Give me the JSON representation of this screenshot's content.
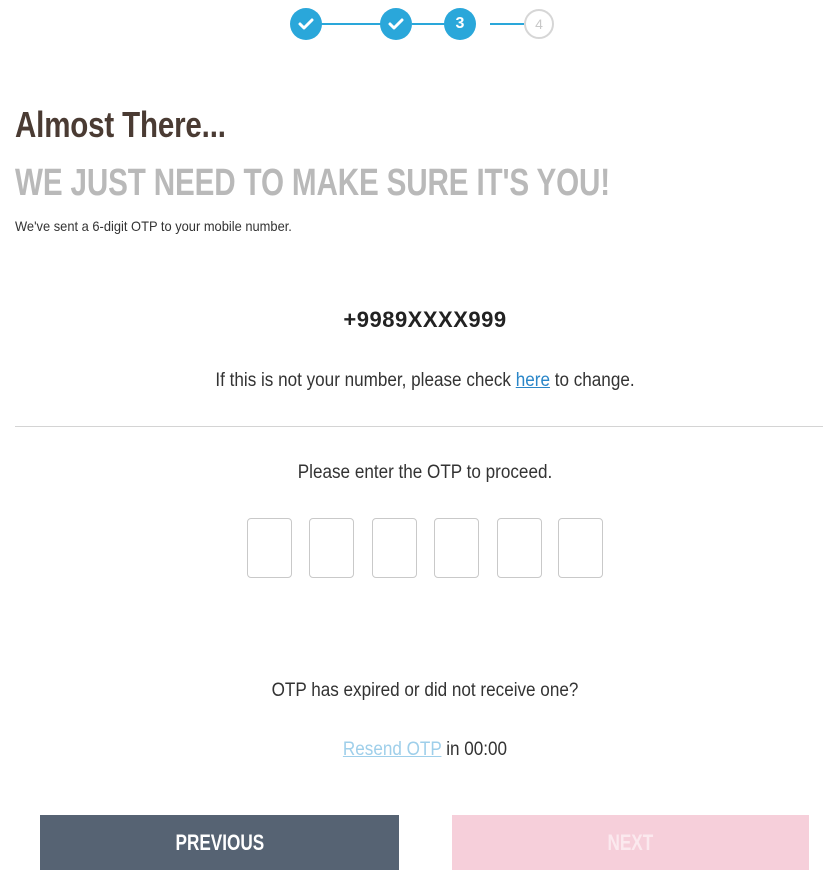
{
  "stepper": {
    "steps": [
      {
        "state": "completed",
        "icon": "check-icon",
        "label": ""
      },
      {
        "state": "completed",
        "icon": "check-icon",
        "label": ""
      },
      {
        "state": "current",
        "label": "3"
      },
      {
        "state": "pending",
        "label": "4"
      }
    ],
    "active_color": "#2aa7da",
    "inactive_color": "#d6d6d6"
  },
  "header": {
    "title": "Almost There...",
    "subtitle": "WE JUST NEED TO MAKE SURE IT'S YOU!",
    "sent_message": "We've sent a 6-digit OTP to your mobile number."
  },
  "phone": {
    "number": "+9989XXXX999",
    "change_prefix": "If this is not your number, please check ",
    "change_link": "here",
    "change_suffix": " to change."
  },
  "otp": {
    "prompt": "Please enter the OTP to proceed.",
    "digits": [
      "",
      "",
      "",
      "",
      "",
      ""
    ],
    "expired_text": "OTP has expired or did not receive one?",
    "resend_link": "Resend OTP",
    "timer_prefix": " in ",
    "timer": "00:00"
  },
  "buttons": {
    "previous": "PREVIOUS",
    "next": "NEXT",
    "previous_color": "#566373",
    "next_color": "#f6cfda"
  }
}
